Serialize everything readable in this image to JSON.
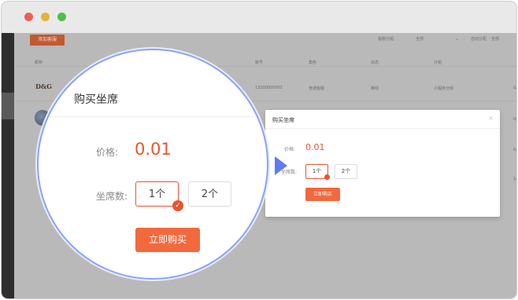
{
  "window": {
    "traffic_lights": [
      "close",
      "minimize",
      "maximize"
    ]
  },
  "background_page": {
    "add_button": "添加客服",
    "filters": [
      {
        "label": "客服分组",
        "value": "全部"
      },
      {
        "label": "自动分配",
        "value": "全部"
      }
    ],
    "table_headers": [
      "昵称",
      "账号",
      "角色",
      "状态",
      "分组"
    ],
    "rows": [
      {
        "logo": "D&G",
        "name": "小…",
        "account": "13200000001",
        "role": "普通客服",
        "status": "离线",
        "group": "小程序分组",
        "extra": "0/"
      },
      {
        "name": "",
        "extra": "0/"
      }
    ],
    "side_values": [
      "0/",
      "0/",
      "0/",
      "1/"
    ]
  },
  "modal": {
    "title": "购买坐席",
    "close_icon": "close-icon",
    "price_label": "价格:",
    "price_value": "0.01",
    "seat_label": "坐席数:",
    "seat_options": [
      "1个",
      "2个"
    ],
    "selected_seat": "1个",
    "buy_button": "立即购买"
  },
  "magnifier": {
    "title": "购买坐席",
    "price_label": "价格:",
    "price_value": "0.01",
    "seat_label": "坐席数:",
    "seat_options": [
      "1个",
      "2个"
    ],
    "buy_button": "立即购买"
  },
  "colors": {
    "accent": "#e8542f",
    "button": "#f2693d",
    "pointer": "#5d7cf2",
    "magnifier_border": "#8aa3f5"
  }
}
